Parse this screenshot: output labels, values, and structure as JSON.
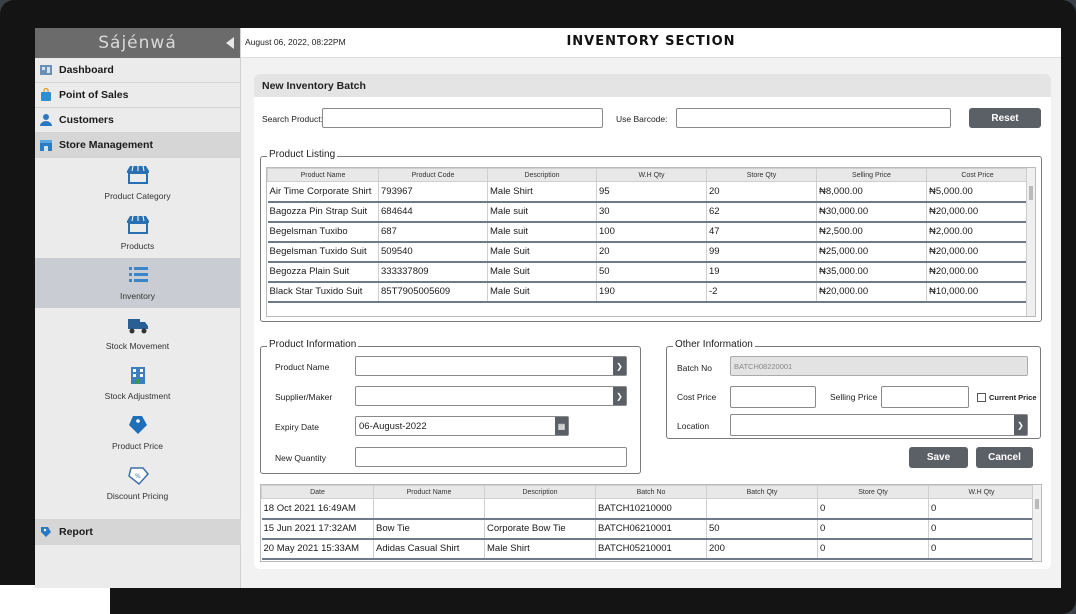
{
  "app": {
    "brand": "Sájénwá",
    "title": "INVENTORY SECTION",
    "datetime": "August 06, 2022, 08:22PM"
  },
  "sidebar": {
    "items": [
      {
        "label": "Dashboard"
      },
      {
        "label": "Point of Sales"
      },
      {
        "label": "Customers"
      },
      {
        "label": "Store Management"
      }
    ],
    "sub_items": [
      {
        "label": "Product Category",
        "icon": "storefront-icon"
      },
      {
        "label": "Products",
        "icon": "storefront-icon"
      },
      {
        "label": "Inventory",
        "icon": "list-icon"
      },
      {
        "label": "Stock Movement",
        "icon": "truck-icon"
      },
      {
        "label": "Stock Adjustment",
        "icon": "building-icon"
      },
      {
        "label": "Product Price",
        "icon": "price-tag-icon"
      },
      {
        "label": "Discount Pricing",
        "icon": "discount-tag-icon"
      }
    ],
    "report": "Report"
  },
  "batch": {
    "title": "New Inventory Batch",
    "search_label": "Search Product:",
    "barcode_label": "Use Barcode:",
    "reset": "Reset"
  },
  "listing": {
    "legend": "Product Listing",
    "columns": [
      "Product Name",
      "Product Code",
      "Description",
      "W.H Qty",
      "Store Qty",
      "Selling Price",
      "Cost Price"
    ],
    "rows": [
      [
        "Air Time Corporate Shirt",
        "793967",
        "Male Shirt",
        "95",
        "20",
        "₦8,000.00",
        "₦5,000.00"
      ],
      [
        "Bagozza Pin Strap Suit",
        "684644",
        "Male suit",
        "30",
        "62",
        "₦30,000.00",
        "₦20,000.00"
      ],
      [
        "Begelsman Tuxibo",
        "687",
        "Male suit",
        "100",
        "47",
        "₦2,500.00",
        "₦2,000.00"
      ],
      [
        "Begelsman Tuxido Suit",
        "509540",
        "Male Suit",
        "20",
        "99",
        "₦25,000.00",
        "₦20,000.00"
      ],
      [
        "Begozza Plain Suit",
        "333337809",
        "Male Suit",
        "50",
        "19",
        "₦35,000.00",
        "₦20,000.00"
      ],
      [
        "Black Star Tuxido Suit",
        "85T7905005609",
        "Male Suit",
        "190",
        "-2",
        "₦20,000.00",
        "₦10,000.00"
      ]
    ]
  },
  "product_info": {
    "legend": "Product Information",
    "name_label": "Product Name",
    "supplier_label": "Supplier/Maker",
    "expiry_label": "Expiry Date",
    "expiry_value": "06-August-2022",
    "quantity_label": "New Quantity"
  },
  "other_info": {
    "legend": "Other Information",
    "batch_label": "Batch No",
    "batch_value": "BATCH08220001",
    "cost_label": "Cost Price",
    "selling_label": "Selling Price",
    "current_price_label": "Current Price",
    "location_label": "Location"
  },
  "actions": {
    "save": "Save",
    "cancel": "Cancel"
  },
  "history": {
    "columns": [
      "Date",
      "Product Name",
      "Description",
      "Batch No",
      "Batch Qty",
      "Store Qty",
      "W.H Qty"
    ],
    "rows": [
      [
        "18 Oct 2021 16:49AM",
        "",
        "",
        "BATCH10210000",
        "",
        "0",
        "0"
      ],
      [
        "15 Jun 2021 17:32AM",
        "Bow Tie",
        "Corporate Bow Tie",
        "BATCH06210001",
        "50",
        "0",
        "0"
      ],
      [
        "20 May 2021 15:33AM",
        "Adidas Casual Shirt",
        "Male Shirt",
        "BATCH05210001",
        "200",
        "0",
        "0"
      ]
    ]
  },
  "colors": {
    "accent_button": "#5b5f66",
    "sidebar_active": "#c9cdd3"
  }
}
